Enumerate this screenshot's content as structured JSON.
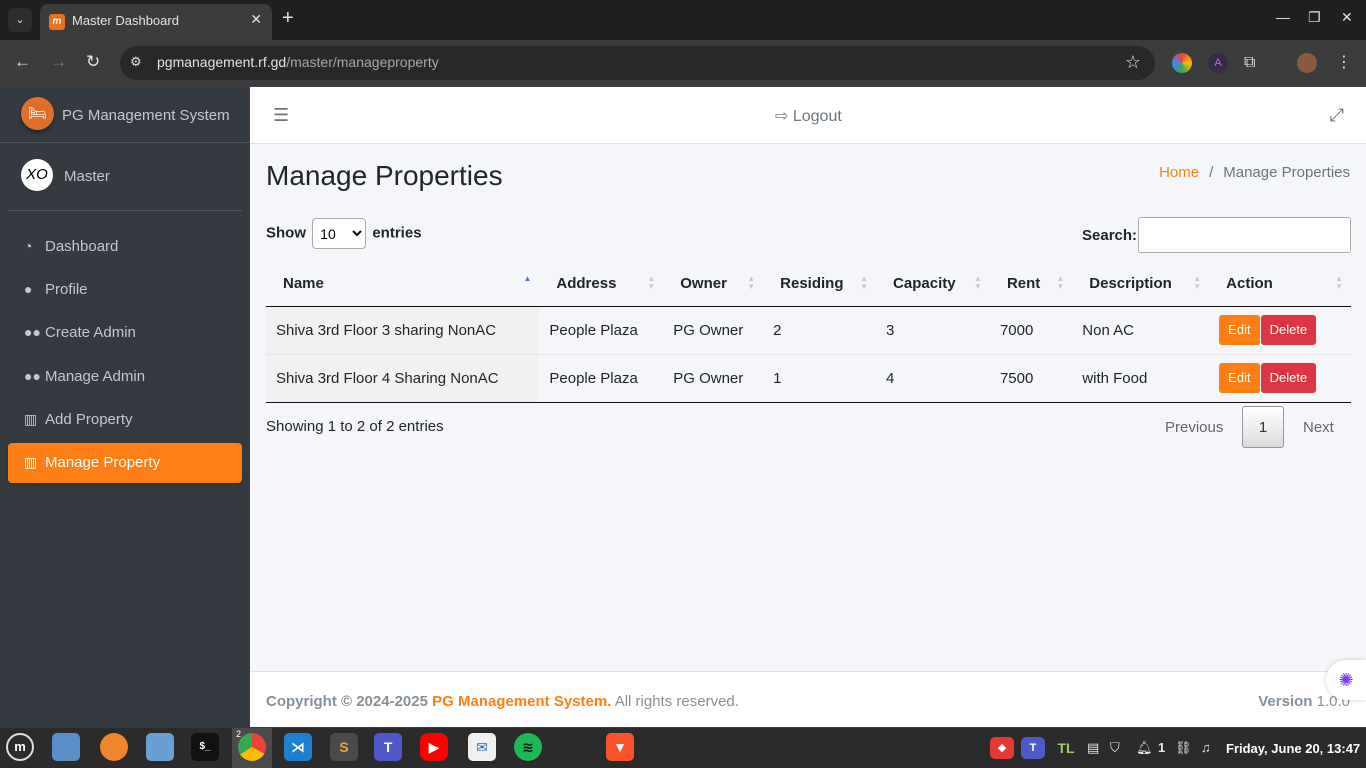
{
  "browser": {
    "tab_title": "Master Dashboard",
    "url_host": "pgmanagement.rf.gd",
    "url_path": "/master/manageproperty",
    "icons": [
      "tab-list-icon",
      "close-icon",
      "new-tab-icon",
      "back-icon",
      "forward-icon",
      "reload-icon",
      "site-info-icon",
      "star-icon",
      "extensions-icon",
      "menu-icon"
    ]
  },
  "sidebar": {
    "brand": "PG Management System",
    "user": "Master",
    "user_avatar_text": "XO",
    "items": [
      {
        "label": "Dashboard",
        "icon": "tachometer-icon"
      },
      {
        "label": "Profile",
        "icon": "user-icon"
      },
      {
        "label": "Create Admin",
        "icon": "users-icon"
      },
      {
        "label": "Manage Admin",
        "icon": "users-icon"
      },
      {
        "label": "Add Property",
        "icon": "building-icon"
      },
      {
        "label": "Manage Property",
        "icon": "building-icon",
        "active": true
      }
    ]
  },
  "header": {
    "logout_label": "Logout"
  },
  "page": {
    "title": "Manage Properties",
    "breadcrumb_home": "Home",
    "breadcrumb_current": "Manage Properties"
  },
  "datatable": {
    "show_label": "Show",
    "entries_label": "entries",
    "page_length": "10",
    "search_label": "Search:",
    "search_value": "",
    "columns": [
      "Name",
      "Address",
      "Owner",
      "Residing",
      "Capacity",
      "Rent",
      "Description",
      "Action"
    ],
    "rows": [
      {
        "name": "Shiva 3rd Floor 3 sharing NonAC",
        "address": "People Plaza",
        "owner": "PG Owner",
        "residing": "2",
        "capacity": "3",
        "rent": "7000",
        "description": "Non AC"
      },
      {
        "name": "Shiva 3rd Floor 4 Sharing NonAC",
        "address": "People Plaza",
        "owner": "PG Owner",
        "residing": "1",
        "capacity": "4",
        "rent": "7500",
        "description": "with Food"
      }
    ],
    "edit_label": "Edit",
    "delete_label": "Delete",
    "info": "Showing 1 to 2 of 2 entries",
    "prev_label": "Previous",
    "current_page": "1",
    "next_label": "Next"
  },
  "footer": {
    "copyright_prefix": "Copyright © 2024-2025",
    "brand": "PG Management System.",
    "rights": "All rights reserved.",
    "version_label": "Version",
    "version": "1.0.0"
  },
  "taskbar": {
    "chrome_badge": "2",
    "tray_count": "1",
    "clock": "Friday, June 20, 13:47"
  },
  "colors": {
    "accent": "#fd7e14",
    "danger": "#dc3545",
    "sidebar_bg": "#343a40"
  }
}
